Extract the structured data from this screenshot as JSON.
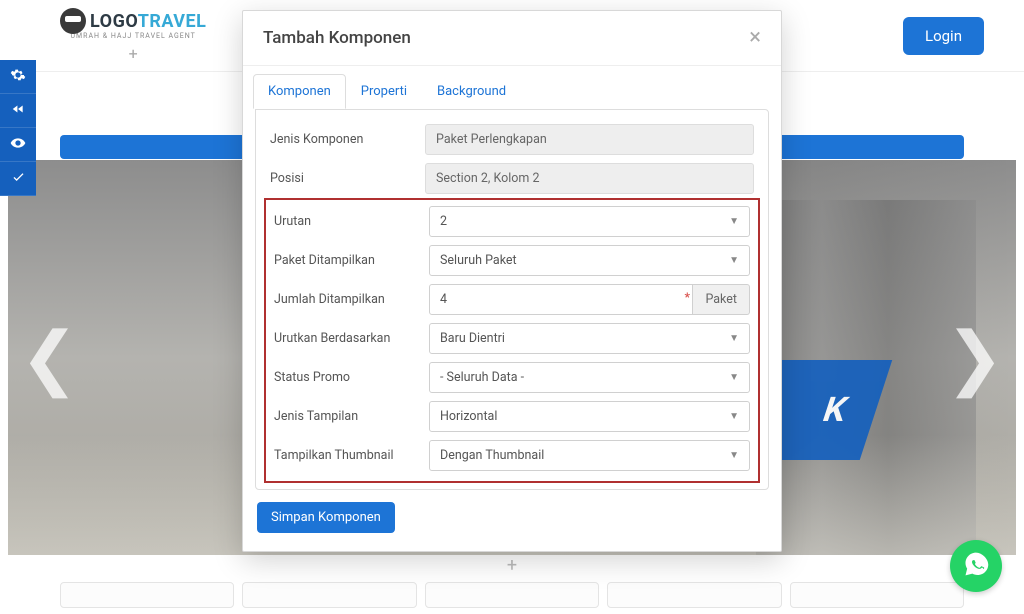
{
  "header": {
    "logo_part1": "LOGO",
    "logo_part2": "TRAVEL",
    "logo_subtitle": "UMRAH & HAJJ TRAVEL AGENT",
    "login_label": "Login"
  },
  "hero": {
    "angled_text": "K"
  },
  "modal": {
    "title": "Tambah Komponen",
    "tabs": [
      "Komponen",
      "Properti",
      "Background"
    ],
    "fields": {
      "jenis_komponen": {
        "label": "Jenis Komponen",
        "value": "Paket Perlengkapan"
      },
      "posisi": {
        "label": "Posisi",
        "value": "Section 2, Kolom 2"
      },
      "urutan": {
        "label": "Urutan",
        "value": "2"
      },
      "paket_ditampilkan": {
        "label": "Paket Ditampilkan",
        "value": "Seluruh Paket"
      },
      "jumlah_ditampilkan": {
        "label": "Jumlah Ditampilkan",
        "value": "4",
        "suffix": "Paket"
      },
      "urutkan_berdasarkan": {
        "label": "Urutkan Berdasarkan",
        "value": "Baru Dientri"
      },
      "status_promo": {
        "label": "Status Promo",
        "value": "- Seluruh Data -"
      },
      "jenis_tampilan": {
        "label": "Jenis Tampilan",
        "value": "Horizontal"
      },
      "tampilkan_thumbnail": {
        "label": "Tampilkan Thumbnail",
        "value": "Dengan Thumbnail"
      }
    },
    "save_label": "Simpan Komponen"
  }
}
